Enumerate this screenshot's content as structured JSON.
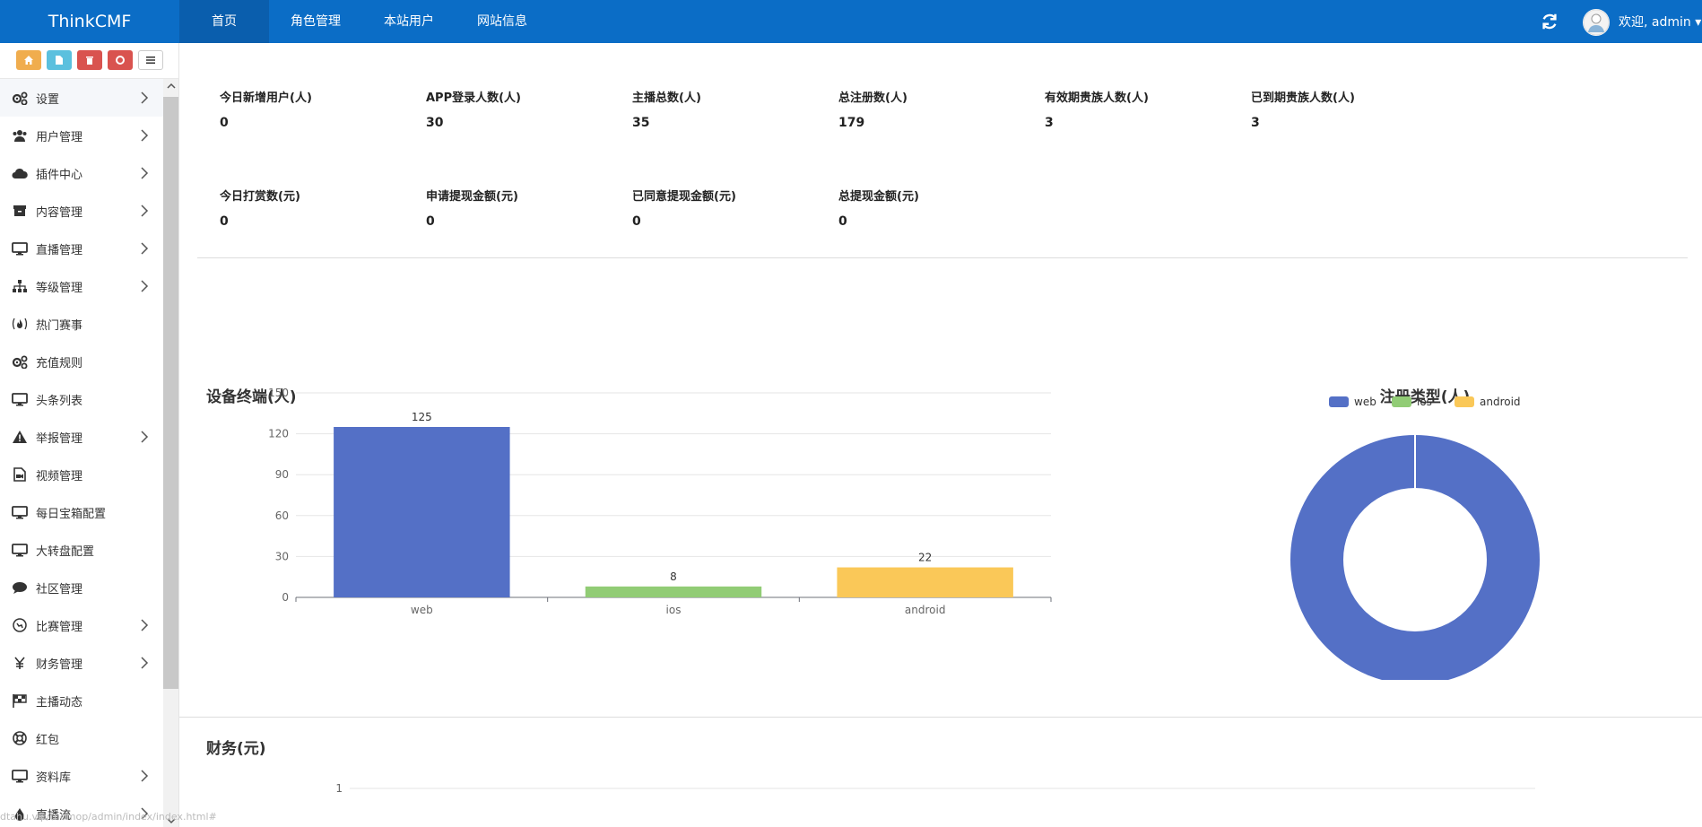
{
  "brand": "ThinkCMF",
  "topnav": [
    {
      "label": "首页",
      "active": true
    },
    {
      "label": "角色管理",
      "active": false
    },
    {
      "label": "本站用户",
      "active": false
    },
    {
      "label": "网站信息",
      "active": false
    }
  ],
  "user": {
    "welcome": "欢迎, admin",
    "caret": "▾"
  },
  "shortcuts": [
    {
      "icon": "home-icon",
      "color": "#f0ad4e"
    },
    {
      "icon": "file-icon",
      "color": "#5bc0de"
    },
    {
      "icon": "trash-icon",
      "color": "#d9534f"
    },
    {
      "icon": "recycle-icon",
      "color": "#d9534f"
    },
    {
      "icon": "list-icon",
      "color": "#ffffff"
    }
  ],
  "sidebar": {
    "items": [
      {
        "label": "设置",
        "icon": "cogs-icon",
        "submenu": true,
        "active": true
      },
      {
        "label": "用户管理",
        "icon": "users-icon",
        "submenu": true
      },
      {
        "label": "插件中心",
        "icon": "cloud-icon",
        "submenu": true
      },
      {
        "label": "内容管理",
        "icon": "archive-icon",
        "submenu": true
      },
      {
        "label": "直播管理",
        "icon": "desktop-icon",
        "submenu": true
      },
      {
        "label": "等级管理",
        "icon": "sitemap-icon",
        "submenu": true
      },
      {
        "label": "热门赛事",
        "icon": "fire-icon",
        "submenu": false
      },
      {
        "label": "充值规则",
        "icon": "cogs-icon",
        "submenu": false
      },
      {
        "label": "头条列表",
        "icon": "desktop-icon",
        "submenu": false
      },
      {
        "label": "举报管理",
        "icon": "warning-icon",
        "submenu": true
      },
      {
        "label": "视频管理",
        "icon": "video-file-icon",
        "submenu": false
      },
      {
        "label": "每日宝箱配置",
        "icon": "desktop-icon",
        "submenu": false
      },
      {
        "label": "大转盘配置",
        "icon": "desktop-icon",
        "submenu": false
      },
      {
        "label": "社区管理",
        "icon": "comment-icon",
        "submenu": false
      },
      {
        "label": "比赛管理",
        "icon": "soccer-icon",
        "submenu": true
      },
      {
        "label": "财务管理",
        "icon": "yen-icon",
        "submenu": true
      },
      {
        "label": "主播动态",
        "icon": "flag-icon",
        "submenu": false
      },
      {
        "label": "红包",
        "icon": "lifebuoy-icon",
        "submenu": false
      },
      {
        "label": "资料库",
        "icon": "desktop-icon",
        "submenu": true
      },
      {
        "label": "直播流",
        "icon": "drop-icon",
        "submenu": true
      }
    ]
  },
  "status_url": "dtahu.vip/tnomop/admin/index/index.html#",
  "stats": [
    {
      "label": "今日新增用户(人)",
      "value": "0"
    },
    {
      "label": "APP登录人数(人)",
      "value": "30"
    },
    {
      "label": "主播总数(人)",
      "value": "35"
    },
    {
      "label": "总注册数(人)",
      "value": "179"
    },
    {
      "label": "有效期贵族人数(人)",
      "value": "3"
    },
    {
      "label": "已到期贵族人数(人)",
      "value": "3"
    },
    {
      "label": "今日打赏数(元)",
      "value": "0"
    },
    {
      "label": "申请提现金额(元)",
      "value": "0"
    },
    {
      "label": "已同意提现金额(元)",
      "value": "0"
    },
    {
      "label": "总提现金额(元)",
      "value": "0"
    }
  ],
  "chart_data": [
    {
      "type": "bar",
      "title": "设备终端(人)",
      "categories": [
        "web",
        "ios",
        "android"
      ],
      "values": [
        125,
        8,
        22
      ],
      "colors": [
        "#5470c6",
        "#91cc75",
        "#fac858"
      ],
      "yticks": [
        0,
        30,
        60,
        90,
        120,
        150
      ],
      "ylim": [
        0,
        150
      ],
      "grid": true
    },
    {
      "type": "pie",
      "title": "注册类型(人)",
      "legend": [
        "web",
        "ios",
        "android"
      ],
      "legend_position": "top",
      "colors": [
        "#5470c6",
        "#91cc75",
        "#fac858"
      ],
      "values": [
        179,
        0,
        0
      ],
      "donut": true
    },
    {
      "type": "line",
      "title": "财务(元)",
      "yticks": [
        1
      ],
      "grid": true
    }
  ]
}
